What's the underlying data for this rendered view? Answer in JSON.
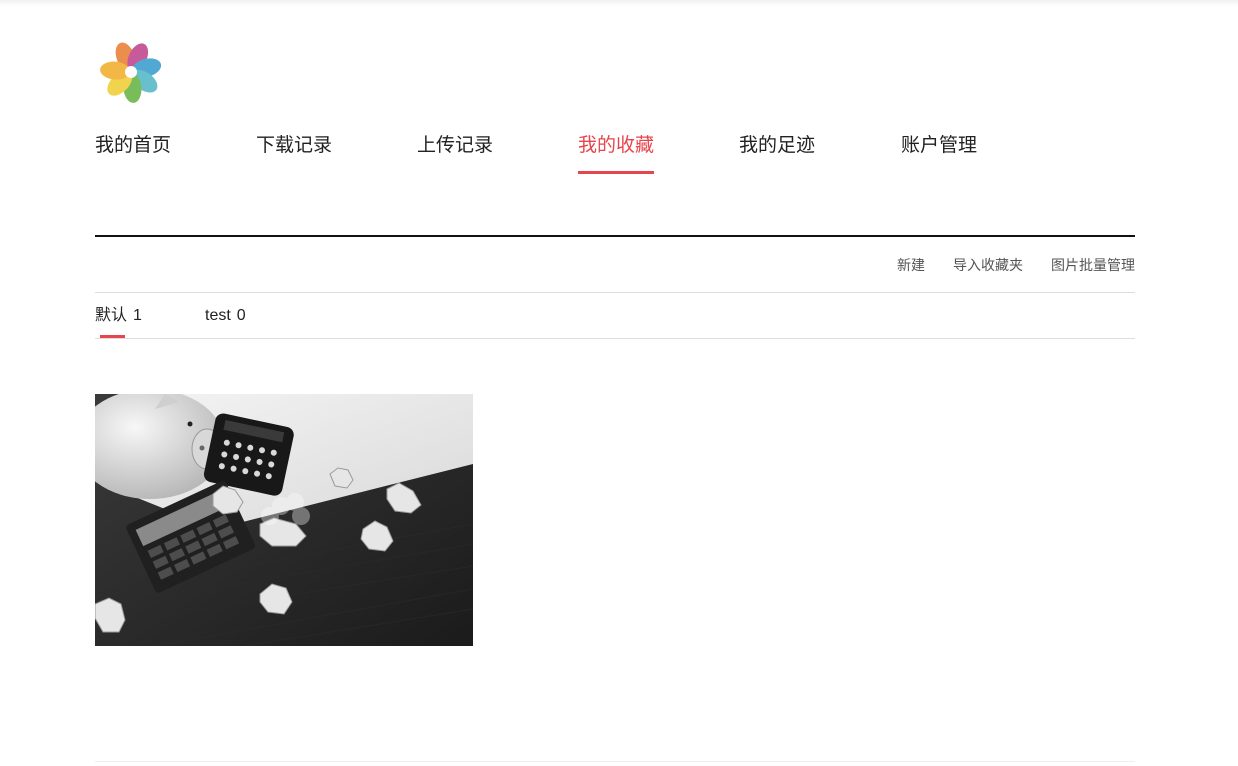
{
  "nav": {
    "items": [
      {
        "label": "我的首页"
      },
      {
        "label": "下载记录"
      },
      {
        "label": "上传记录"
      },
      {
        "label": "我的收藏",
        "active": true
      },
      {
        "label": "我的足迹"
      },
      {
        "label": "账户管理"
      }
    ]
  },
  "actions": {
    "new_label": "新建",
    "import_label": "导入收藏夹",
    "batch_label": "图片批量管理"
  },
  "folders": [
    {
      "name": "默认",
      "count": "1",
      "active": true
    },
    {
      "name": "test",
      "count": "0"
    }
  ],
  "favorites": [
    {
      "image": "piggy-bank-calculators-photo"
    }
  ],
  "colors": {
    "accent": "#e7454e",
    "text": "#222222",
    "muted": "#555555"
  }
}
